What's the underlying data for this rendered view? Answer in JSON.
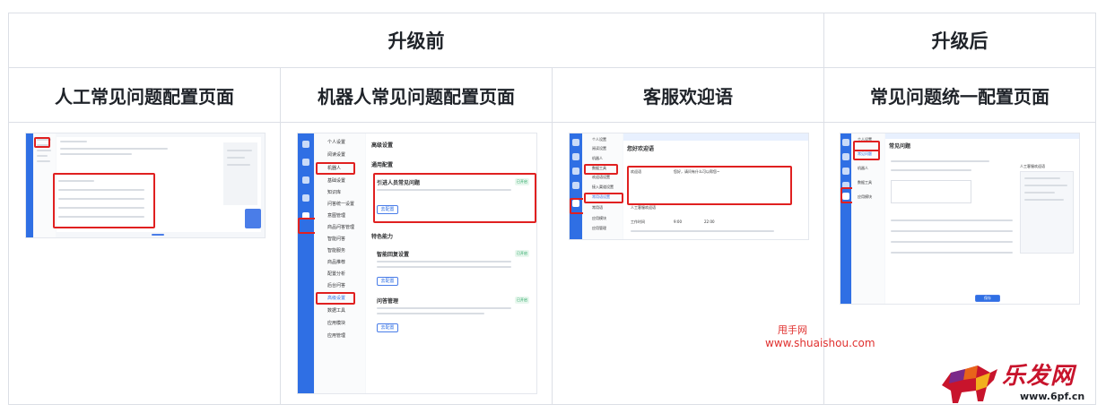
{
  "table": {
    "header_before": "升级前",
    "header_after": "升级后",
    "col1_title": "人工常见问题配置页面",
    "col2_title": "机器人常见问题配置页面",
    "col3_title": "客服欢迎语",
    "col4_title": "常见问题统一配置页面"
  },
  "shot2": {
    "menu": [
      "个人设置",
      "阅读设置",
      "机器人",
      "基础设置",
      "知识库",
      "问答统一设置",
      "意图管理",
      "商品问答管理",
      "智能问答",
      "智能服务",
      "商品推荐",
      "配置分析",
      "后台问答",
      "高级设置",
      "数据工具",
      "应用模块",
      "应用管理"
    ],
    "heading": "高级设置",
    "section1": "通用配置",
    "card1_title": "引进人员常见问题",
    "card1_tag": "已开启",
    "card1_btn": "去配置",
    "section2": "特色能力",
    "card2_title": "智能回复设置",
    "card2_tag": "已开启",
    "card2_btn": "去配置",
    "card3_title": "问答管理",
    "card3_tag": "已开启",
    "card3_btn": "去配置"
  },
  "shot3": {
    "menu": [
      "个人设置",
      "阅读设置",
      "机器人",
      "数据工具",
      "欢迎语设置",
      "接入渠道设置",
      "常用语设置",
      "常用语",
      "应用模块",
      "应用管理"
    ],
    "heading": "您好欢迎语",
    "box_title": "欢迎语",
    "box_text": "您好，请问有什么可以帮您~",
    "row1_label": "人工客服欢迎语",
    "row2_label": "工作时间",
    "time_start": "9:00",
    "time_end": "22:00"
  },
  "shot4": {
    "menu": [
      "个人设置",
      "常见问题",
      "机器人",
      "数据工具",
      "应用模块"
    ],
    "heading": "常见问题",
    "chat_title": "人工客服欢迎语",
    "confirm_btn": "保存"
  },
  "watermark": {
    "line1": "甩手网",
    "line2": "www.shuaishou.com",
    "logo_text": "乐发网",
    "logo_url": "www.6pf.cn"
  }
}
